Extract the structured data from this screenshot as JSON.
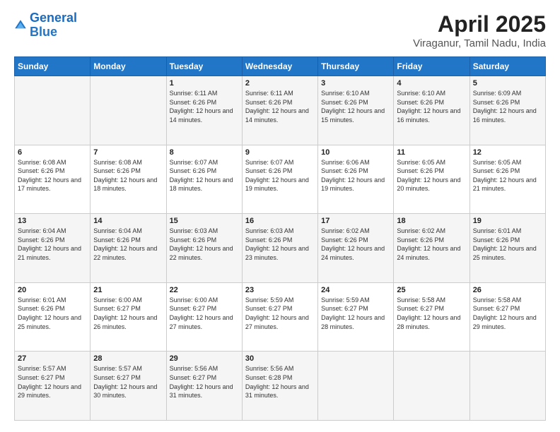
{
  "logo": {
    "line1": "General",
    "line2": "Blue"
  },
  "title": "April 2025",
  "subtitle": "Viraganur, Tamil Nadu, India",
  "days_of_week": [
    "Sunday",
    "Monday",
    "Tuesday",
    "Wednesday",
    "Thursday",
    "Friday",
    "Saturday"
  ],
  "weeks": [
    [
      {
        "day": "",
        "detail": ""
      },
      {
        "day": "",
        "detail": ""
      },
      {
        "day": "1",
        "detail": "Sunrise: 6:11 AM\nSunset: 6:26 PM\nDaylight: 12 hours and 14 minutes."
      },
      {
        "day": "2",
        "detail": "Sunrise: 6:11 AM\nSunset: 6:26 PM\nDaylight: 12 hours and 14 minutes."
      },
      {
        "day": "3",
        "detail": "Sunrise: 6:10 AM\nSunset: 6:26 PM\nDaylight: 12 hours and 15 minutes."
      },
      {
        "day": "4",
        "detail": "Sunrise: 6:10 AM\nSunset: 6:26 PM\nDaylight: 12 hours and 16 minutes."
      },
      {
        "day": "5",
        "detail": "Sunrise: 6:09 AM\nSunset: 6:26 PM\nDaylight: 12 hours and 16 minutes."
      }
    ],
    [
      {
        "day": "6",
        "detail": "Sunrise: 6:08 AM\nSunset: 6:26 PM\nDaylight: 12 hours and 17 minutes."
      },
      {
        "day": "7",
        "detail": "Sunrise: 6:08 AM\nSunset: 6:26 PM\nDaylight: 12 hours and 18 minutes."
      },
      {
        "day": "8",
        "detail": "Sunrise: 6:07 AM\nSunset: 6:26 PM\nDaylight: 12 hours and 18 minutes."
      },
      {
        "day": "9",
        "detail": "Sunrise: 6:07 AM\nSunset: 6:26 PM\nDaylight: 12 hours and 19 minutes."
      },
      {
        "day": "10",
        "detail": "Sunrise: 6:06 AM\nSunset: 6:26 PM\nDaylight: 12 hours and 19 minutes."
      },
      {
        "day": "11",
        "detail": "Sunrise: 6:05 AM\nSunset: 6:26 PM\nDaylight: 12 hours and 20 minutes."
      },
      {
        "day": "12",
        "detail": "Sunrise: 6:05 AM\nSunset: 6:26 PM\nDaylight: 12 hours and 21 minutes."
      }
    ],
    [
      {
        "day": "13",
        "detail": "Sunrise: 6:04 AM\nSunset: 6:26 PM\nDaylight: 12 hours and 21 minutes."
      },
      {
        "day": "14",
        "detail": "Sunrise: 6:04 AM\nSunset: 6:26 PM\nDaylight: 12 hours and 22 minutes."
      },
      {
        "day": "15",
        "detail": "Sunrise: 6:03 AM\nSunset: 6:26 PM\nDaylight: 12 hours and 22 minutes."
      },
      {
        "day": "16",
        "detail": "Sunrise: 6:03 AM\nSunset: 6:26 PM\nDaylight: 12 hours and 23 minutes."
      },
      {
        "day": "17",
        "detail": "Sunrise: 6:02 AM\nSunset: 6:26 PM\nDaylight: 12 hours and 24 minutes."
      },
      {
        "day": "18",
        "detail": "Sunrise: 6:02 AM\nSunset: 6:26 PM\nDaylight: 12 hours and 24 minutes."
      },
      {
        "day": "19",
        "detail": "Sunrise: 6:01 AM\nSunset: 6:26 PM\nDaylight: 12 hours and 25 minutes."
      }
    ],
    [
      {
        "day": "20",
        "detail": "Sunrise: 6:01 AM\nSunset: 6:26 PM\nDaylight: 12 hours and 25 minutes."
      },
      {
        "day": "21",
        "detail": "Sunrise: 6:00 AM\nSunset: 6:27 PM\nDaylight: 12 hours and 26 minutes."
      },
      {
        "day": "22",
        "detail": "Sunrise: 6:00 AM\nSunset: 6:27 PM\nDaylight: 12 hours and 27 minutes."
      },
      {
        "day": "23",
        "detail": "Sunrise: 5:59 AM\nSunset: 6:27 PM\nDaylight: 12 hours and 27 minutes."
      },
      {
        "day": "24",
        "detail": "Sunrise: 5:59 AM\nSunset: 6:27 PM\nDaylight: 12 hours and 28 minutes."
      },
      {
        "day": "25",
        "detail": "Sunrise: 5:58 AM\nSunset: 6:27 PM\nDaylight: 12 hours and 28 minutes."
      },
      {
        "day": "26",
        "detail": "Sunrise: 5:58 AM\nSunset: 6:27 PM\nDaylight: 12 hours and 29 minutes."
      }
    ],
    [
      {
        "day": "27",
        "detail": "Sunrise: 5:57 AM\nSunset: 6:27 PM\nDaylight: 12 hours and 29 minutes."
      },
      {
        "day": "28",
        "detail": "Sunrise: 5:57 AM\nSunset: 6:27 PM\nDaylight: 12 hours and 30 minutes."
      },
      {
        "day": "29",
        "detail": "Sunrise: 5:56 AM\nSunset: 6:27 PM\nDaylight: 12 hours and 31 minutes."
      },
      {
        "day": "30",
        "detail": "Sunrise: 5:56 AM\nSunset: 6:28 PM\nDaylight: 12 hours and 31 minutes."
      },
      {
        "day": "",
        "detail": ""
      },
      {
        "day": "",
        "detail": ""
      },
      {
        "day": "",
        "detail": ""
      }
    ]
  ]
}
